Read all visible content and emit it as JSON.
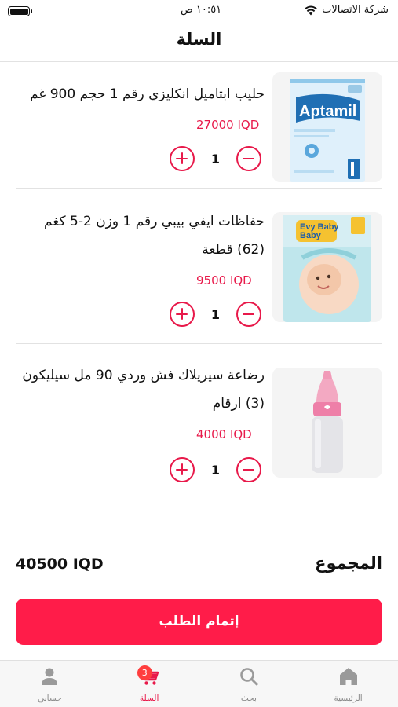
{
  "status_bar": {
    "carrier": "شركة الاتصالات",
    "time": "١٠:٥١ ص",
    "battery_level": 1.0
  },
  "header": {
    "title": "السلة"
  },
  "cart": {
    "items": [
      {
        "name": "حليب ابتاميل انكليزي رقم 1 حجم 900 غم",
        "price": "27000 IQD",
        "quantity": "1",
        "image_icon": "aptamil-milk-can-image"
      },
      {
        "name": "حفاظات ايفي بيبي رقم 1 وزن 2-5 كغم (62) قطعة",
        "price": "9500 IQD",
        "quantity": "1",
        "image_icon": "evy-baby-diapers-image",
        "image_text": "Evy Baby"
      },
      {
        "name": "رضاعة سيريلاك فش وردي 90 مل سيليكون (3) ارقام",
        "price": "4000 IQD",
        "quantity": "1",
        "image_icon": "pink-feeding-bottle-image"
      }
    ],
    "total_label": "المجموع",
    "total_value": "40500 IQD",
    "checkout_label": "إتمام الطلب"
  },
  "tab_bar": {
    "tabs": [
      {
        "label": "الرئيسية",
        "icon": "home-icon",
        "active": false
      },
      {
        "label": "بحث",
        "icon": "search-icon",
        "active": false
      },
      {
        "label": "السلة",
        "icon": "cart-icon",
        "active": true,
        "badge": "3"
      },
      {
        "label": "حسابي",
        "icon": "user-icon",
        "active": false
      }
    ]
  },
  "colors": {
    "accent": "#ff1c49",
    "price": "#e8194a",
    "inactive_tab": "#9a9a9a"
  }
}
